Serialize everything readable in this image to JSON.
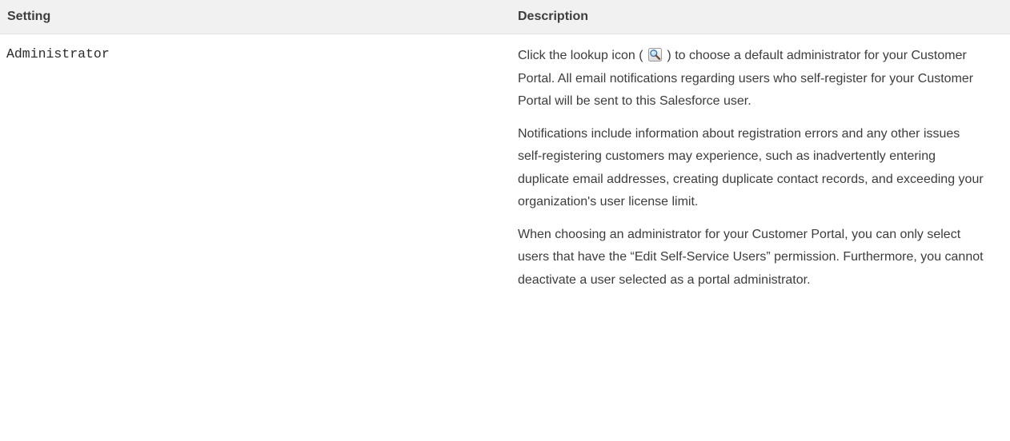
{
  "table": {
    "headers": {
      "setting": "Setting",
      "description": "Description"
    },
    "row": {
      "setting": "Administrator",
      "description": {
        "p1_before_icon": "Click the lookup icon (",
        "p1_icon": "lookup-icon",
        "p1_after_icon": ") to choose a default administrator for your Customer Portal. All email notifications regarding users who self-register for your Customer Portal will be sent to this Salesforce user.",
        "p2": "Notifications include information about registration errors and any other issues self-registering customers may experience, such as inadvertently entering duplicate email addresses, creating duplicate contact records, and exceeding your organization's user license limit.",
        "p3": "When choosing an administrator for your Customer Portal, you can only select users that have the “Edit Self-Service Users” permission. Furthermore, you cannot deactivate a user selected as a portal administrator."
      }
    }
  }
}
